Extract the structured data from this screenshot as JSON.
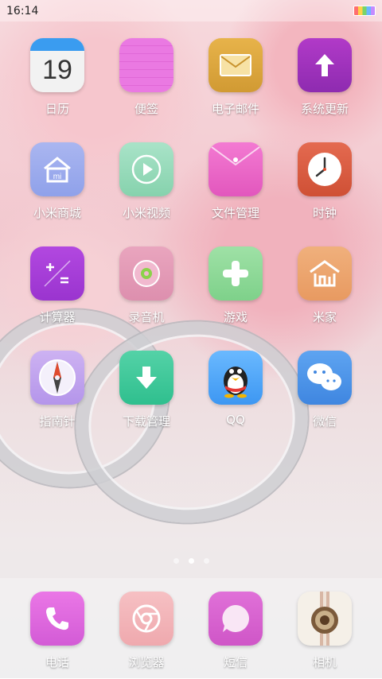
{
  "status_bar": {
    "time": "16:14"
  },
  "apps": [
    [
      {
        "name": "calendar",
        "label": "日历",
        "icon": "calendar-icon",
        "day": "19"
      },
      {
        "name": "notes",
        "label": "便签",
        "icon": "notes-icon"
      },
      {
        "name": "email",
        "label": "电子邮件",
        "icon": "mail-icon"
      },
      {
        "name": "system-update",
        "label": "系统更新",
        "icon": "update-icon"
      }
    ],
    [
      {
        "name": "mi-mall",
        "label": "小米商城",
        "icon": "mi-store-icon"
      },
      {
        "name": "mi-video",
        "label": "小米视频",
        "icon": "video-play-icon"
      },
      {
        "name": "file-manager",
        "label": "文件管理",
        "icon": "folder-icon"
      },
      {
        "name": "clock",
        "label": "时钟",
        "icon": "clock-icon"
      }
    ],
    [
      {
        "name": "calculator",
        "label": "计算器",
        "icon": "calculator-icon"
      },
      {
        "name": "recorder",
        "label": "录音机",
        "icon": "recorder-icon"
      },
      {
        "name": "games",
        "label": "游戏",
        "icon": "gamepad-icon"
      },
      {
        "name": "mi-home",
        "label": "米家",
        "icon": "mi-home-icon"
      }
    ],
    [
      {
        "name": "compass",
        "label": "指南针",
        "icon": "compass-icon"
      },
      {
        "name": "downloads",
        "label": "下载管理",
        "icon": "download-icon"
      },
      {
        "name": "qq",
        "label": "QQ",
        "icon": "qq-penguin-icon"
      },
      {
        "name": "wechat",
        "label": "微信",
        "icon": "wechat-icon"
      }
    ]
  ],
  "page_indicator": {
    "count": 3,
    "active_index": 1
  },
  "dock": [
    {
      "name": "phone",
      "label": "电话",
      "icon": "phone-icon"
    },
    {
      "name": "browser",
      "label": "浏览器",
      "icon": "browser-icon"
    },
    {
      "name": "messages",
      "label": "短信",
      "icon": "message-icon"
    },
    {
      "name": "camera",
      "label": "相机",
      "icon": "camera-icon"
    }
  ]
}
